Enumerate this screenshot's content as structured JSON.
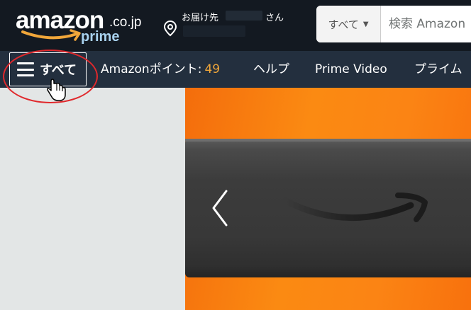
{
  "header": {
    "logo": {
      "text": "amazon",
      "tld": ".co.jp",
      "sub": "prime"
    },
    "deliver_to": {
      "label": "お届け先",
      "suffix": "さん"
    },
    "search": {
      "category": "すべて",
      "placeholder": "検索 Amazon"
    }
  },
  "nav": {
    "all_label": "すべて",
    "points_label": "Amazonポイント:",
    "points_value": "49",
    "links": [
      "ヘルプ",
      "Prime Video",
      "プライム"
    ]
  },
  "colors": {
    "header_bg": "#131921",
    "nav_bg": "#232f3e",
    "accent_orange": "#f0a63a",
    "prime_blue": "#a9d2ef",
    "highlight_red": "#e0282c"
  },
  "icons": [
    "location-pin-icon",
    "caret-down-icon",
    "hamburger-menu-icon",
    "hand-cursor-icon",
    "chevron-left-icon"
  ]
}
